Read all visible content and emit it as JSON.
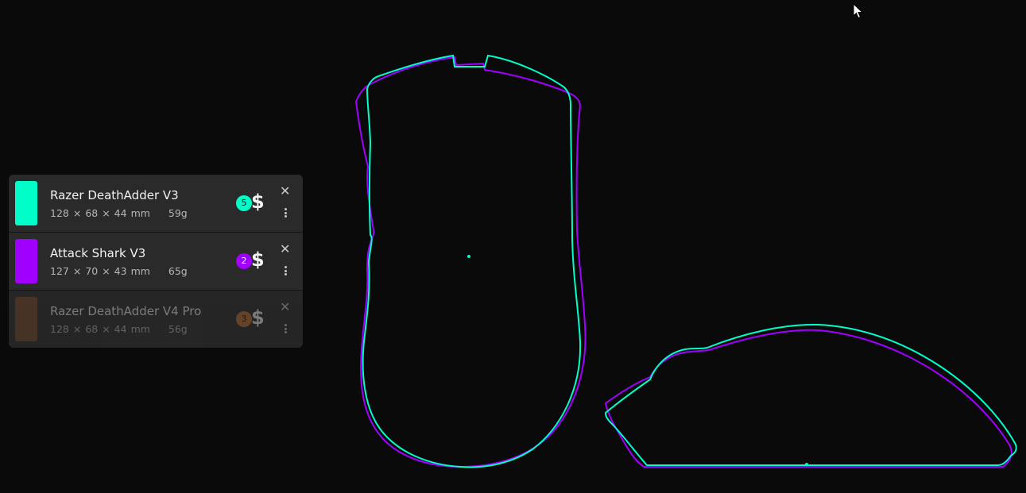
{
  "mice": [
    {
      "name": "Razer DeathAdder V3",
      "length": "128",
      "width": "68",
      "height": "44",
      "unit": "mm",
      "weight": "59g",
      "price_tier": "5",
      "color": "#00ffc8",
      "dimmed": false
    },
    {
      "name": "Attack Shark V3",
      "length": "127",
      "width": "70",
      "height": "43",
      "unit": "mm",
      "weight": "65g",
      "price_tier": "2",
      "color": "#a000ff",
      "dimmed": false
    },
    {
      "name": "Razer DeathAdder V4 Pro",
      "length": "128",
      "width": "68",
      "height": "44",
      "unit": "mm",
      "weight": "56g",
      "price_tier": "3",
      "color": "#7a4a2a",
      "dimmed": true
    }
  ],
  "symbols": {
    "times": "×",
    "dollar": "$",
    "close": "✕"
  },
  "colors": {
    "background": "#0a0a0b",
    "panel": "#242424",
    "outline_a": "#00ffc8",
    "outline_b": "#a000ff"
  },
  "icons": [
    "close-icon",
    "kebab-menu-icon",
    "dollar-icon",
    "cursor-icon"
  ]
}
